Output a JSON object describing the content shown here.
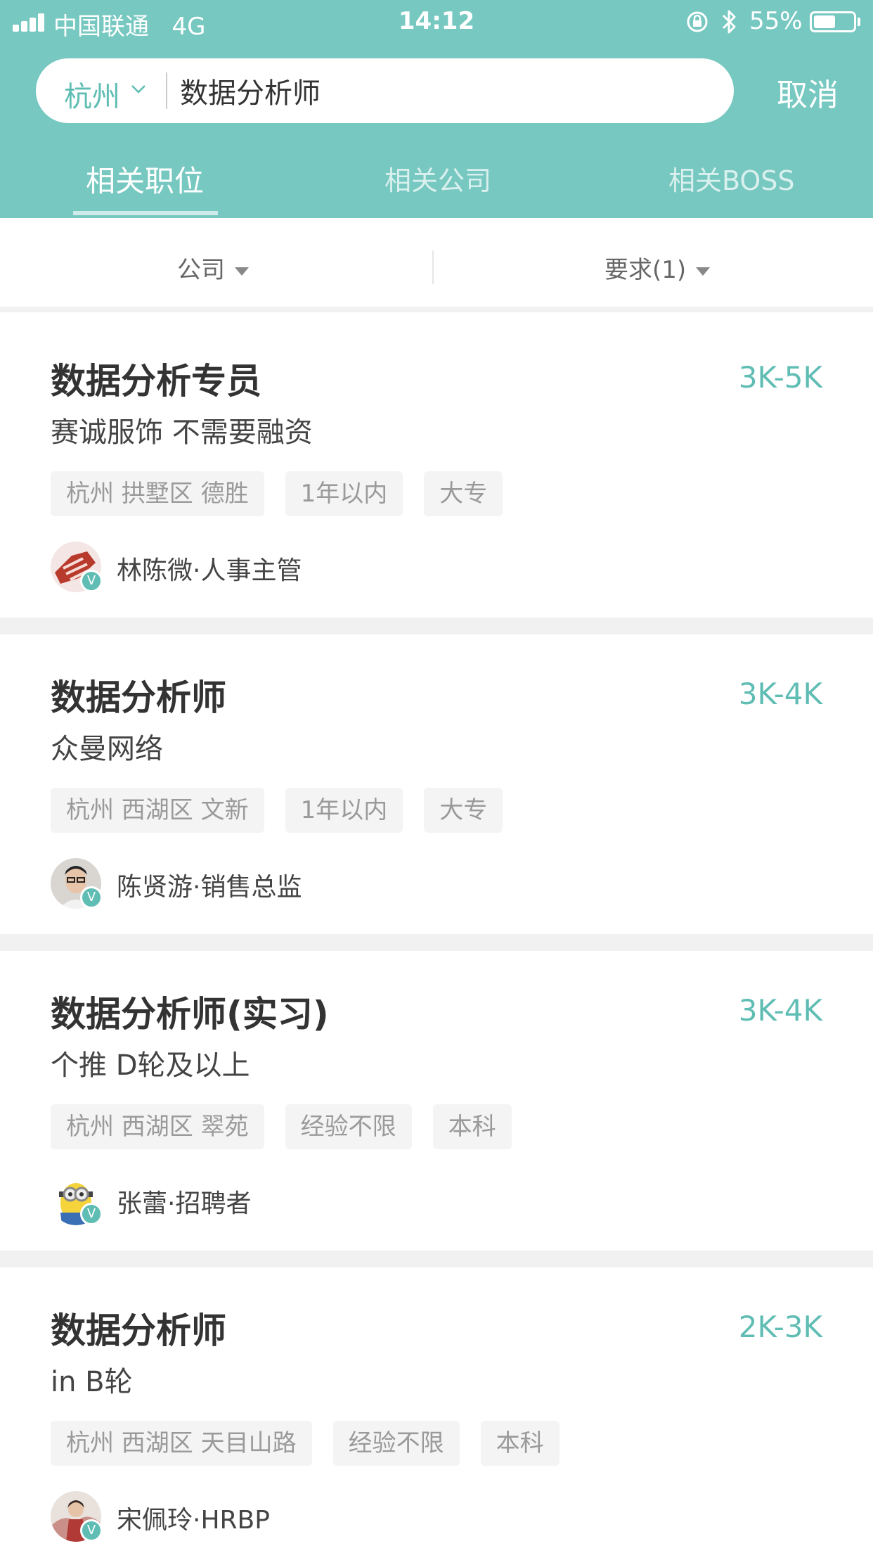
{
  "status_bar": {
    "carrier": "中国联通",
    "network": "4G",
    "time": "14:12",
    "battery": "55%",
    "battery_level": 0.55
  },
  "search": {
    "city": "杭州",
    "query": "数据分析师",
    "cancel": "取消"
  },
  "tabs": [
    {
      "label": "相关职位",
      "active": true
    },
    {
      "label": "相关公司",
      "active": false
    },
    {
      "label": "相关BOSS",
      "active": false
    }
  ],
  "filters": {
    "company": "公司",
    "requirements": "要求(1)"
  },
  "jobs": [
    {
      "title": "数据分析专员",
      "salary": "3K-5K",
      "company": "赛诚服饰 不需要融资",
      "tags": [
        "杭州 拱墅区 德胜",
        "1年以内",
        "大专"
      ],
      "recruiter": "林陈微·人事主管"
    },
    {
      "title": "数据分析师",
      "salary": "3K-4K",
      "company": "众曼网络",
      "tags": [
        "杭州 西湖区 文新",
        "1年以内",
        "大专"
      ],
      "recruiter": "陈贤游·销售总监"
    },
    {
      "title": "数据分析师(实习)",
      "salary": "3K-4K",
      "company": "个推 D轮及以上",
      "tags": [
        "杭州 西湖区 翠苑",
        "经验不限",
        "本科"
      ],
      "recruiter": "张蕾·招聘者"
    },
    {
      "title": "数据分析师",
      "salary": "2K-3K",
      "company": "in B轮",
      "tags": [
        "杭州 西湖区 天目山路",
        "经验不限",
        "本科"
      ],
      "recruiter": "宋佩玲·HRBP"
    }
  ],
  "colors": {
    "header": "#76c8c0",
    "accent": "#5fbdb4"
  },
  "icons": {
    "verified": "V"
  }
}
